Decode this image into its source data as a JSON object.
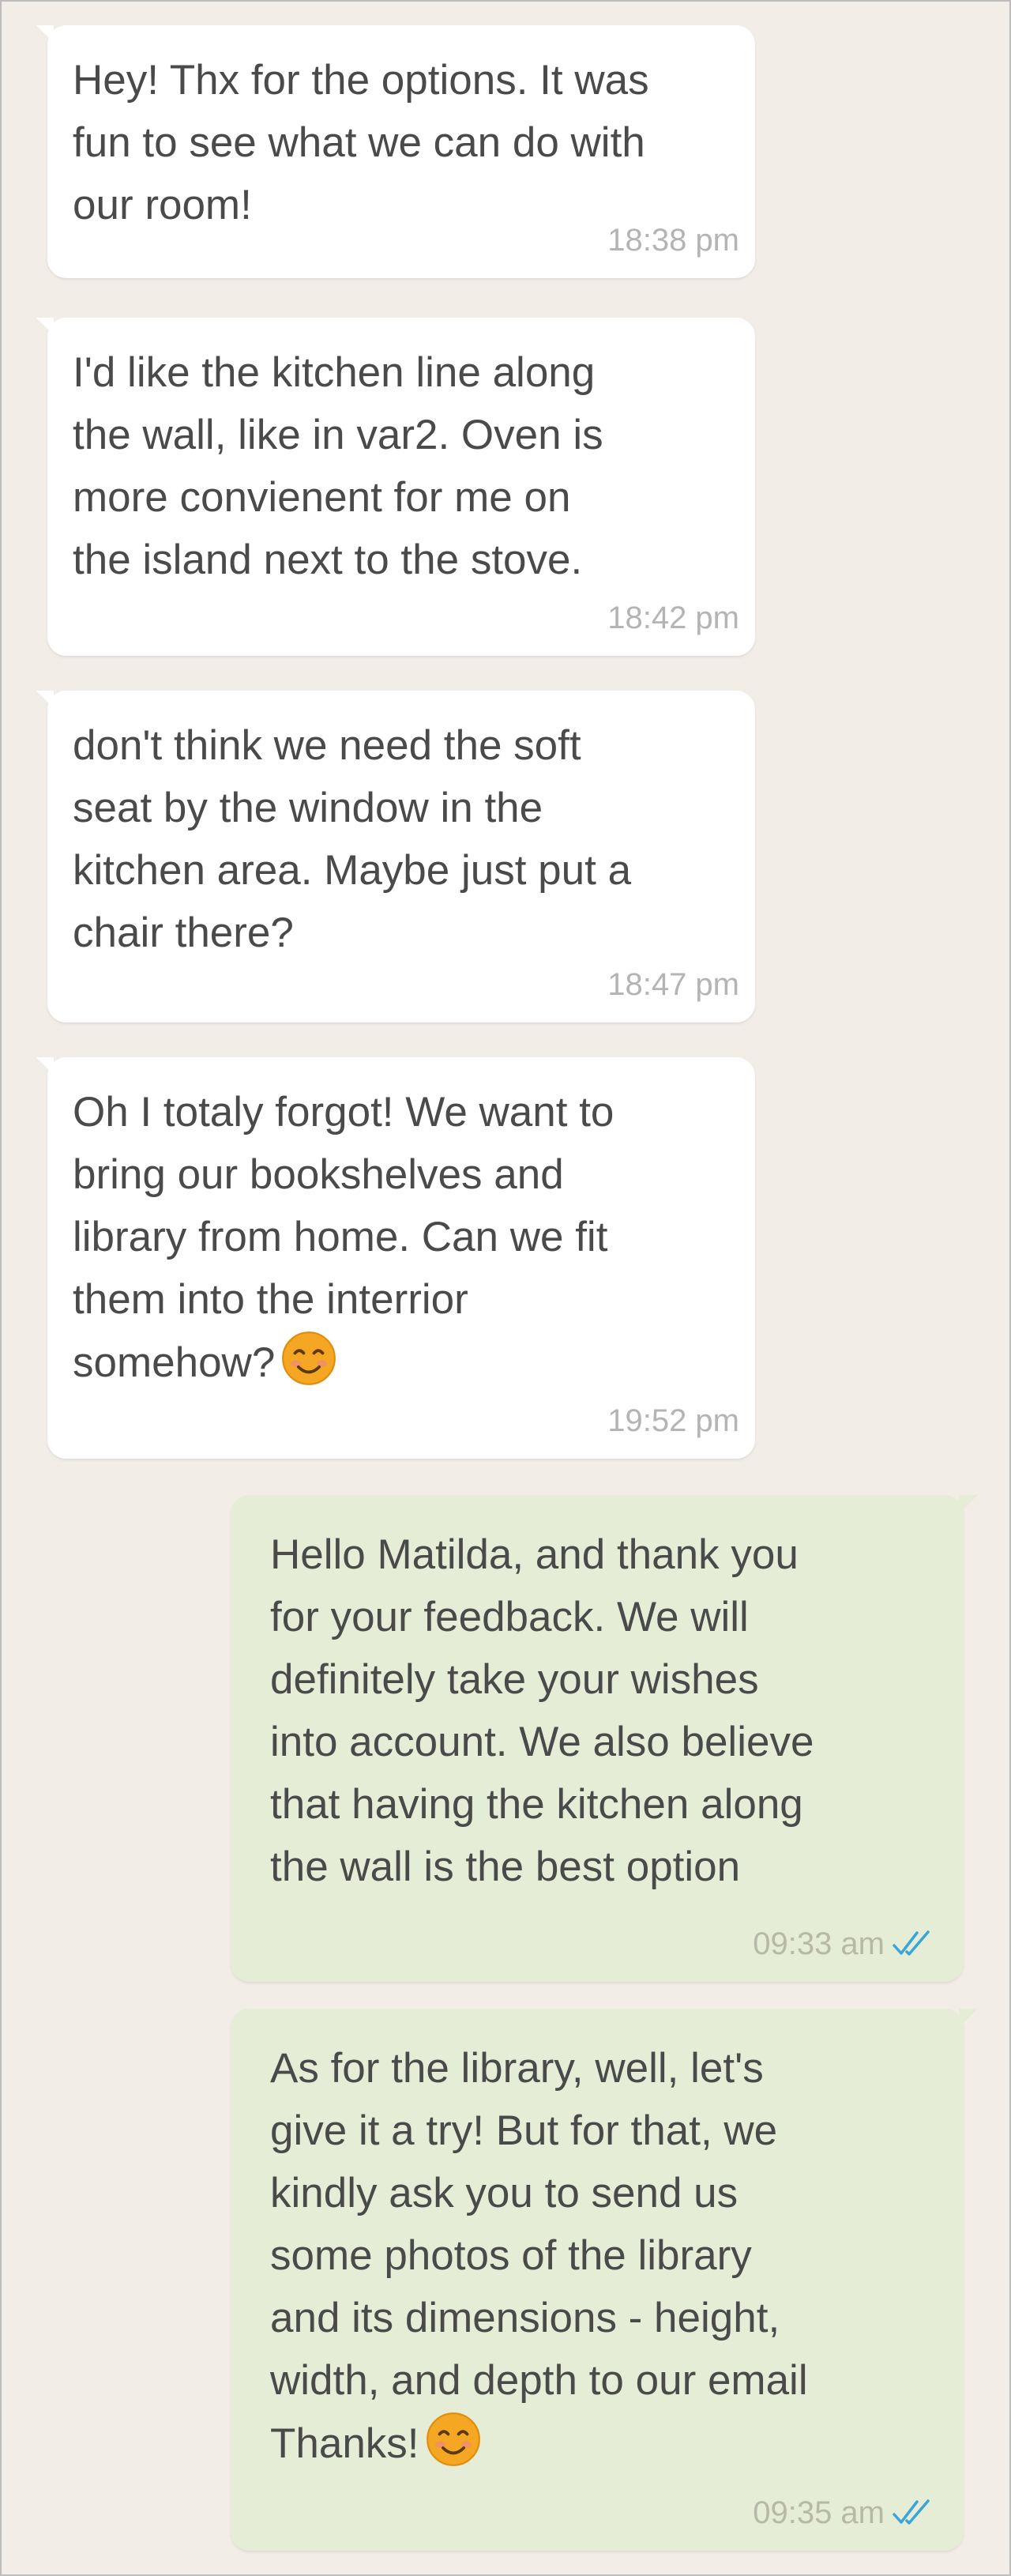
{
  "chat": {
    "messages": [
      {
        "direction": "incoming",
        "text": "Hey! Thx for the options. It was\nfun to see what we can do with\nour room!",
        "time": "18:38 pm"
      },
      {
        "direction": "incoming",
        "text": "I'd like the kitchen line along\nthe wall, like in var2. Oven is\nmore convienent for me on\nthe island next to the stove.",
        "time": "18:42 pm"
      },
      {
        "direction": "incoming",
        "text": "don't think we need the soft\nseat by the window in the\nkitchen area. Maybe just put a\nchair there?",
        "time": "18:47 pm"
      },
      {
        "direction": "incoming",
        "text": "Oh I totaly forgot! We want to\nbring our bookshelves and\nlibrary from home. Can we fit\nthem into the interrior\nsomehow?",
        "emoji": "smiling-face-emoji",
        "time": "19:52 pm"
      },
      {
        "direction": "outgoing",
        "text": "Hello Matilda, and thank you\nfor your feedback. We will\ndefinitely take your wishes\ninto account. We also believe\nthat having the kitchen along\nthe wall is the best option",
        "time": "09:33 am",
        "status_icon": "double-check-icon"
      },
      {
        "direction": "outgoing",
        "text": "As for the library, well, let's\ngive it a try! But for that, we\nkindly ask you to send us\nsome photos of the library\nand its dimensions  - height,\nwidth, and depth to our email\nThanks!",
        "emoji": "smiling-face-emoji",
        "time": "09:35 am",
        "status_icon": "double-check-icon"
      }
    ]
  },
  "colors": {
    "background": "#f3ede8",
    "incoming_bubble": "#ffffff",
    "outgoing_bubble": "#e6edd6",
    "text": "#4a4a4a",
    "timestamp": "#b4b4b4",
    "read_ticks": "#3aa6d8",
    "emoji_face": "#f5a623"
  }
}
